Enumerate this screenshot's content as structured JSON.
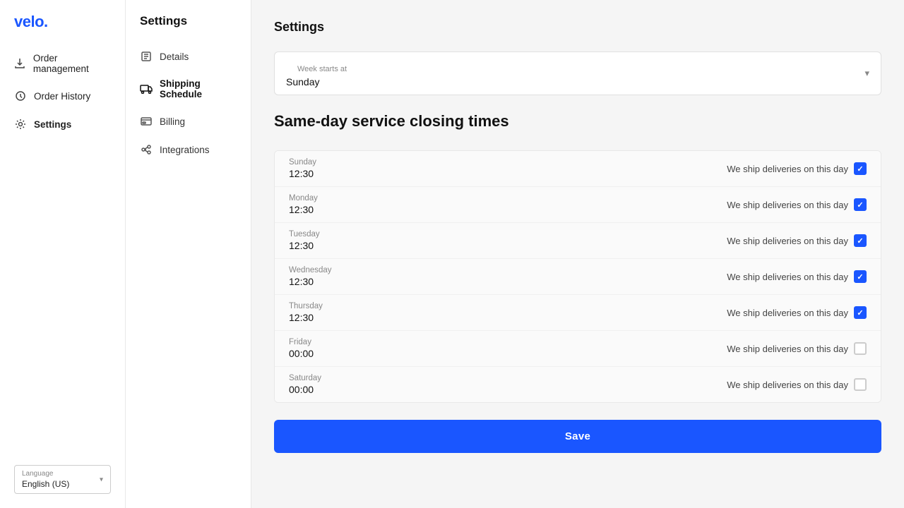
{
  "logo": {
    "text": "velo.",
    "color": "#1a56ff"
  },
  "sidebar": {
    "nav": [
      {
        "id": "order-management",
        "label": "Order management",
        "icon": "download"
      },
      {
        "id": "order-history",
        "label": "Order History",
        "icon": "clock"
      },
      {
        "id": "settings",
        "label": "Settings",
        "icon": "gear",
        "active": true
      }
    ]
  },
  "settings_nav": {
    "title": "Settings",
    "items": [
      {
        "id": "details",
        "label": "Details",
        "icon": "list"
      },
      {
        "id": "shipping-schedule",
        "label": "Shipping Schedule",
        "icon": "truck",
        "active": true
      },
      {
        "id": "billing",
        "label": "Billing",
        "icon": "card"
      },
      {
        "id": "integrations",
        "label": "Integrations",
        "icon": "integrations"
      }
    ]
  },
  "page": {
    "settings_title": "Settings",
    "week_starts_label": "Week starts at",
    "week_starts_value": "Sunday",
    "same_day_title": "Same-day service closing times",
    "days": [
      {
        "id": "sunday",
        "name": "Sunday",
        "time": "12:30",
        "checked": true
      },
      {
        "id": "monday",
        "name": "Monday",
        "time": "12:30",
        "checked": true
      },
      {
        "id": "tuesday",
        "name": "Tuesday",
        "time": "12:30",
        "checked": true
      },
      {
        "id": "wednesday",
        "name": "Wednesday",
        "time": "12:30",
        "checked": true
      },
      {
        "id": "thursday",
        "name": "Thursday",
        "time": "12:30",
        "checked": true
      },
      {
        "id": "friday",
        "name": "Friday",
        "time": "00:00",
        "checked": false
      },
      {
        "id": "saturday",
        "name": "Saturday",
        "time": "00:00",
        "checked": false
      }
    ],
    "ship_label": "We ship deliveries on this day",
    "save_button": "Save"
  },
  "footer": {
    "language_label": "Language",
    "language_value": "English (US)"
  }
}
